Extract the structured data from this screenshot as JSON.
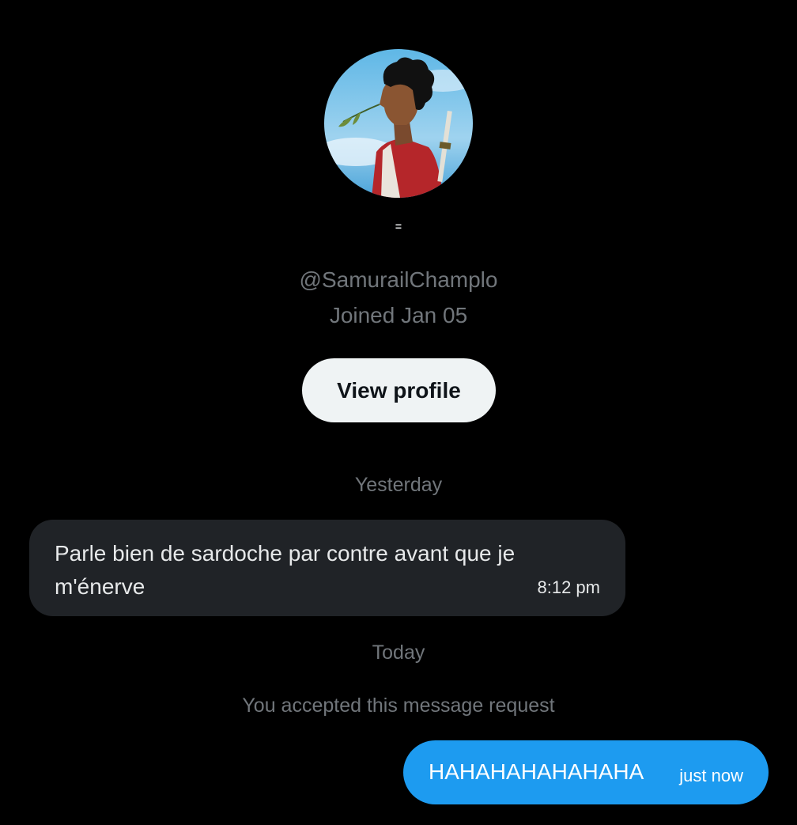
{
  "profile": {
    "display_name": "=",
    "handle": "@SamurailChamplo",
    "joined": "Joined Jan 05",
    "view_profile_label": "View profile"
  },
  "conversation": {
    "groups": [
      {
        "day": "Yesterday",
        "messages": [
          {
            "direction": "incoming",
            "text": "Parle bien de sardoche par contre avant que je m'énerve",
            "time": "8:12 pm"
          }
        ]
      },
      {
        "day": "Today",
        "note": "You accepted this message request",
        "messages": [
          {
            "direction": "outgoing",
            "text": "HAHAHAHAHAHAHA",
            "time": "just now"
          }
        ]
      }
    ]
  },
  "colors": {
    "background": "#000000",
    "incoming_bubble": "#202327",
    "outgoing_bubble": "#1d9bf0",
    "muted_text": "#71767b",
    "button_bg": "#eff3f4"
  },
  "icons": {
    "avatar": "profile-avatar-anime-character"
  }
}
